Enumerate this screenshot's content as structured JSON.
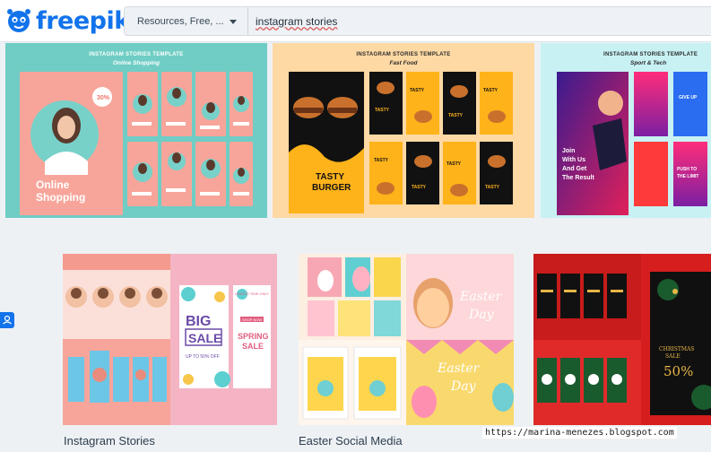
{
  "header": {
    "logo_text": "freepik",
    "filter_label": "Resources, Free, ...",
    "search_query": "instagram stories"
  },
  "banners": [
    {
      "title": "INSTAGRAM STORIES TEMPLATE",
      "subtitle": "Online Shopping",
      "big_text": "Online Shopping",
      "badge": "30%"
    },
    {
      "title": "INSTAGRAM STORIES TEMPLATE",
      "subtitle": "Fast Food",
      "big_text": "TASTY BURGER",
      "tile_text": "TASTY BURGER"
    },
    {
      "title": "INSTAGRAM STORIES TEMPLATE",
      "subtitle": "Sport & Tech",
      "big_text": "Join With Us And Get The Result",
      "tile_text": "PUSH TO THE LIMIT"
    }
  ],
  "cards": [
    {
      "caption": "Instagram Stories",
      "big_sale": "BIG SALE",
      "discount": "UP TO 50% OFF",
      "limited": "LIMITED TIME ONLY",
      "spring_sale": "SPRING SALE",
      "shop_now": "SHOP NOW"
    },
    {
      "caption": "Easter Social Media",
      "easter_day": "Easter Day",
      "happy": "HAPPY"
    },
    {
      "caption": "",
      "xmas": "CHRISTMAS SALE",
      "percent": "50%"
    }
  ],
  "watermark": "https://marina-menezes.blogspot.com",
  "colors": {
    "brand": "#1273eb"
  }
}
